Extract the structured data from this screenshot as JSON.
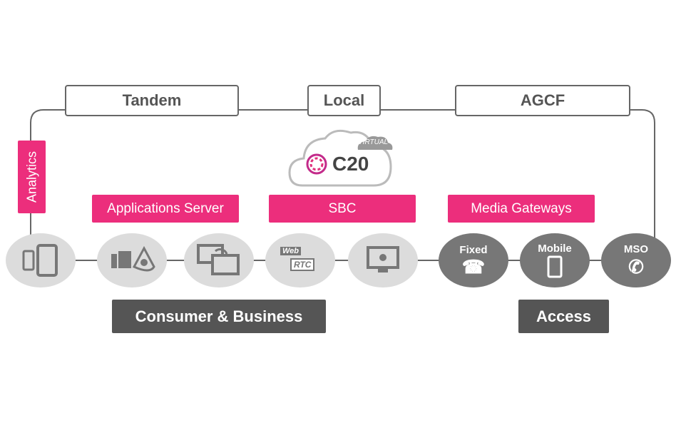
{
  "top_boxes": [
    "Tandem",
    "Local",
    "AGCF"
  ],
  "logo": {
    "text": "C20",
    "badge": "VIRTUAL"
  },
  "analytics": "Analytics",
  "functions": [
    "Applications Server",
    "SBC",
    "Media Gateways"
  ],
  "endpoints": [
    {
      "icon": "mobile-tablet-icon"
    },
    {
      "icon": "desk-phone-conference-icon"
    },
    {
      "icon": "screen-sharing-icon"
    },
    {
      "icon": "webrtc-icon",
      "label_web": "Web",
      "label_rtc": "RTC"
    },
    {
      "icon": "monitor-icon"
    },
    {
      "label": "Fixed",
      "icon": "telephone-icon"
    },
    {
      "label": "Mobile",
      "icon": "mobile-phone-icon"
    },
    {
      "label": "MSO",
      "icon": "phone-handset-icon"
    }
  ],
  "groups": [
    "Consumer & Business",
    "Access"
  ],
  "colors": {
    "accent": "#ec2e7c",
    "line": "#666666",
    "dark": "#555555",
    "light_circle": "#dcdcdc",
    "dark_circle": "#777777"
  }
}
